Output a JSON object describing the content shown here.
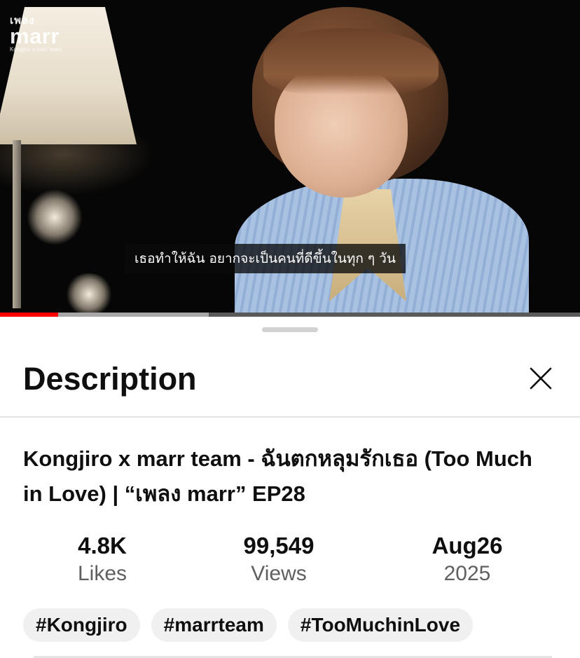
{
  "video": {
    "watermark": {
      "line1": "เพลง",
      "line2": "marr",
      "line3": "Kongjiro x marr team"
    },
    "subtitle": "เธอทำให้ฉัน อยากจะเป็นคนที่ดีขึ้นในทุก ๆ วัน",
    "progress": {
      "played_fraction": 0.1,
      "buffered_fraction": 0.36
    },
    "colors": {
      "progress_played": "#ff0000",
      "progress_buffer": "#a8a8a8"
    }
  },
  "sheet": {
    "title": "Description",
    "close_icon": "close-icon",
    "video_title": "Kongjiro x marr team - ฉันตกหลุมรักเธอ (Too Much in Love) | “เพลง marr” EP28",
    "stats": [
      {
        "value": "4.8K",
        "label": "Likes"
      },
      {
        "value": "99,549",
        "label": "Views"
      },
      {
        "value": "Aug26",
        "label": "2025"
      }
    ],
    "hashtags": [
      "#Kongjiro",
      "#marrteam",
      "#TooMuchinLove"
    ]
  }
}
